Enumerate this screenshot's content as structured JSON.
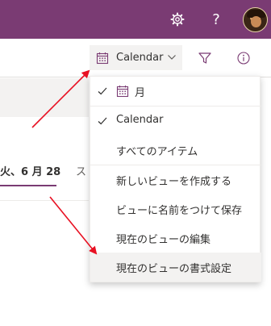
{
  "header": {
    "settings_icon": "gear-icon",
    "help_label": "?",
    "avatar_icon": "user-avatar"
  },
  "command_bar": {
    "view_switcher_label": "Calendar",
    "filter_icon": "filter-icon",
    "info_icon": "info-icon"
  },
  "calendar": {
    "current_date_label": "火、6 月 28",
    "next_label": "ス"
  },
  "view_menu": {
    "items": [
      {
        "label": "月",
        "checked": true,
        "icon": "calendar-icon"
      },
      {
        "label": "Calendar",
        "checked": true
      },
      {
        "label": "すべてのアイテム",
        "checked": false
      },
      {
        "label": "新しいビューを作成する",
        "checked": false
      },
      {
        "label": "ビューに名前をつけて保存",
        "checked": false
      },
      {
        "label": "現在のビューの編集",
        "checked": false
      },
      {
        "label": "現在のビューの書式設定",
        "checked": false,
        "highlighted": true
      }
    ]
  },
  "colors": {
    "header_bg": "#7a3b73",
    "accent": "#7a3b73",
    "annotation_arrow": "#e81123"
  }
}
